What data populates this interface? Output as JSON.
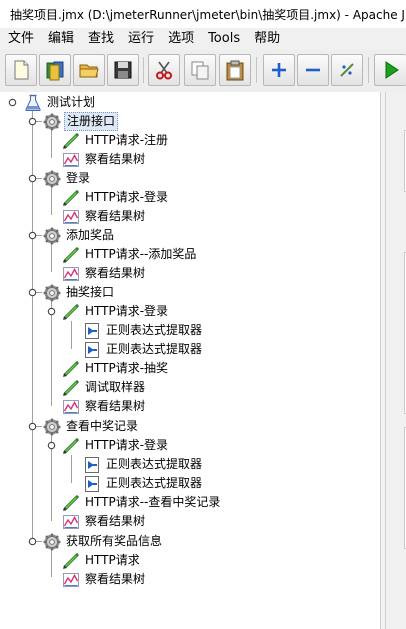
{
  "window": {
    "title": "抽奖项目.jmx (D:\\jmeterRunner\\jmeter\\bin\\抽奖项目.jmx) - Apache JMeter"
  },
  "menu": [
    "文件",
    "编辑",
    "查找",
    "运行",
    "选项",
    "Tools",
    "帮助"
  ],
  "toolbar": {
    "buttons": [
      "new-icon",
      "templates-icon",
      "open-icon",
      "save-icon",
      "cut-icon",
      "copy-icon",
      "paste-icon",
      "expand-icon",
      "collapse-icon",
      "toggle-icon",
      "start-icon"
    ]
  },
  "tree": {
    "root": "测试计划",
    "groups": [
      {
        "label": "注册接口",
        "selected": true,
        "children": [
          {
            "label": "HTTP请求-注册",
            "type": "sampler"
          },
          {
            "label": "察看结果树",
            "type": "listener"
          }
        ]
      },
      {
        "label": "登录",
        "children": [
          {
            "label": "HTTP请求-登录",
            "type": "sampler"
          },
          {
            "label": "察看结果树",
            "type": "listener"
          }
        ]
      },
      {
        "label": "添加奖品",
        "children": [
          {
            "label": "HTTP请求--添加奖品",
            "type": "sampler"
          },
          {
            "label": "察看结果树",
            "type": "listener"
          }
        ]
      },
      {
        "label": "抽奖接口",
        "children": [
          {
            "label": "HTTP请求-登录",
            "type": "sampler",
            "children": [
              {
                "label": "正则表达式提取器",
                "type": "extractor"
              },
              {
                "label": "正则表达式提取器",
                "type": "extractor"
              }
            ]
          },
          {
            "label": "HTTP请求-抽奖",
            "type": "sampler"
          },
          {
            "label": "调试取样器",
            "type": "sampler"
          },
          {
            "label": "察看结果树",
            "type": "listener"
          }
        ]
      },
      {
        "label": "查看中奖记录",
        "children": [
          {
            "label": "HTTP请求-登录",
            "type": "sampler",
            "children": [
              {
                "label": "正则表达式提取器",
                "type": "extractor"
              },
              {
                "label": "正则表达式提取器",
                "type": "extractor"
              }
            ]
          },
          {
            "label": "HTTP请求--查看中奖记录",
            "type": "sampler"
          },
          {
            "label": "察看结果树",
            "type": "listener"
          }
        ]
      },
      {
        "label": "获取所有奖品信息",
        "children": [
          {
            "label": "HTTP请求",
            "type": "sampler"
          },
          {
            "label": "察看结果树",
            "type": "listener"
          }
        ]
      }
    ]
  },
  "colors": {
    "selection": "#dfe9f5",
    "toolbar_bg": "#eeeeee",
    "start": "#1aa31a"
  }
}
